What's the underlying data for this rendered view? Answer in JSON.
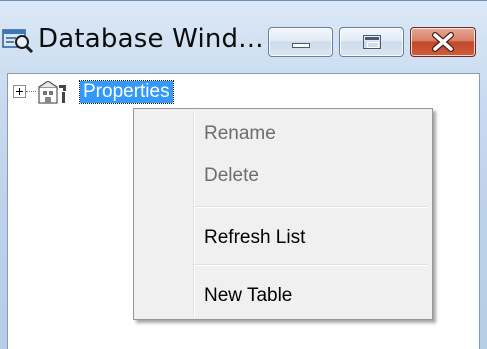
{
  "window": {
    "title": "Database Wind...",
    "icon": "database-window-icon",
    "controls": {
      "minimize_icon": "minimize-icon",
      "maximize_icon": "maximize-icon",
      "close_icon": "close-icon"
    }
  },
  "tree": {
    "nodes": [
      {
        "label": "Properties",
        "icon": "properties-icon",
        "expander": "plus-expander-icon",
        "selected": true
      }
    ]
  },
  "context_menu": {
    "items": [
      {
        "label": "Rename",
        "enabled": false
      },
      {
        "label": "Delete",
        "enabled": false
      },
      {
        "label": "Refresh List",
        "enabled": true
      },
      {
        "label": "New Table",
        "enabled": true
      }
    ]
  },
  "colors": {
    "selection_bg": "#3399ff",
    "menu_bg": "#f0f0f0",
    "close_button": "#c9462c",
    "frame": "#bdd2ea"
  }
}
